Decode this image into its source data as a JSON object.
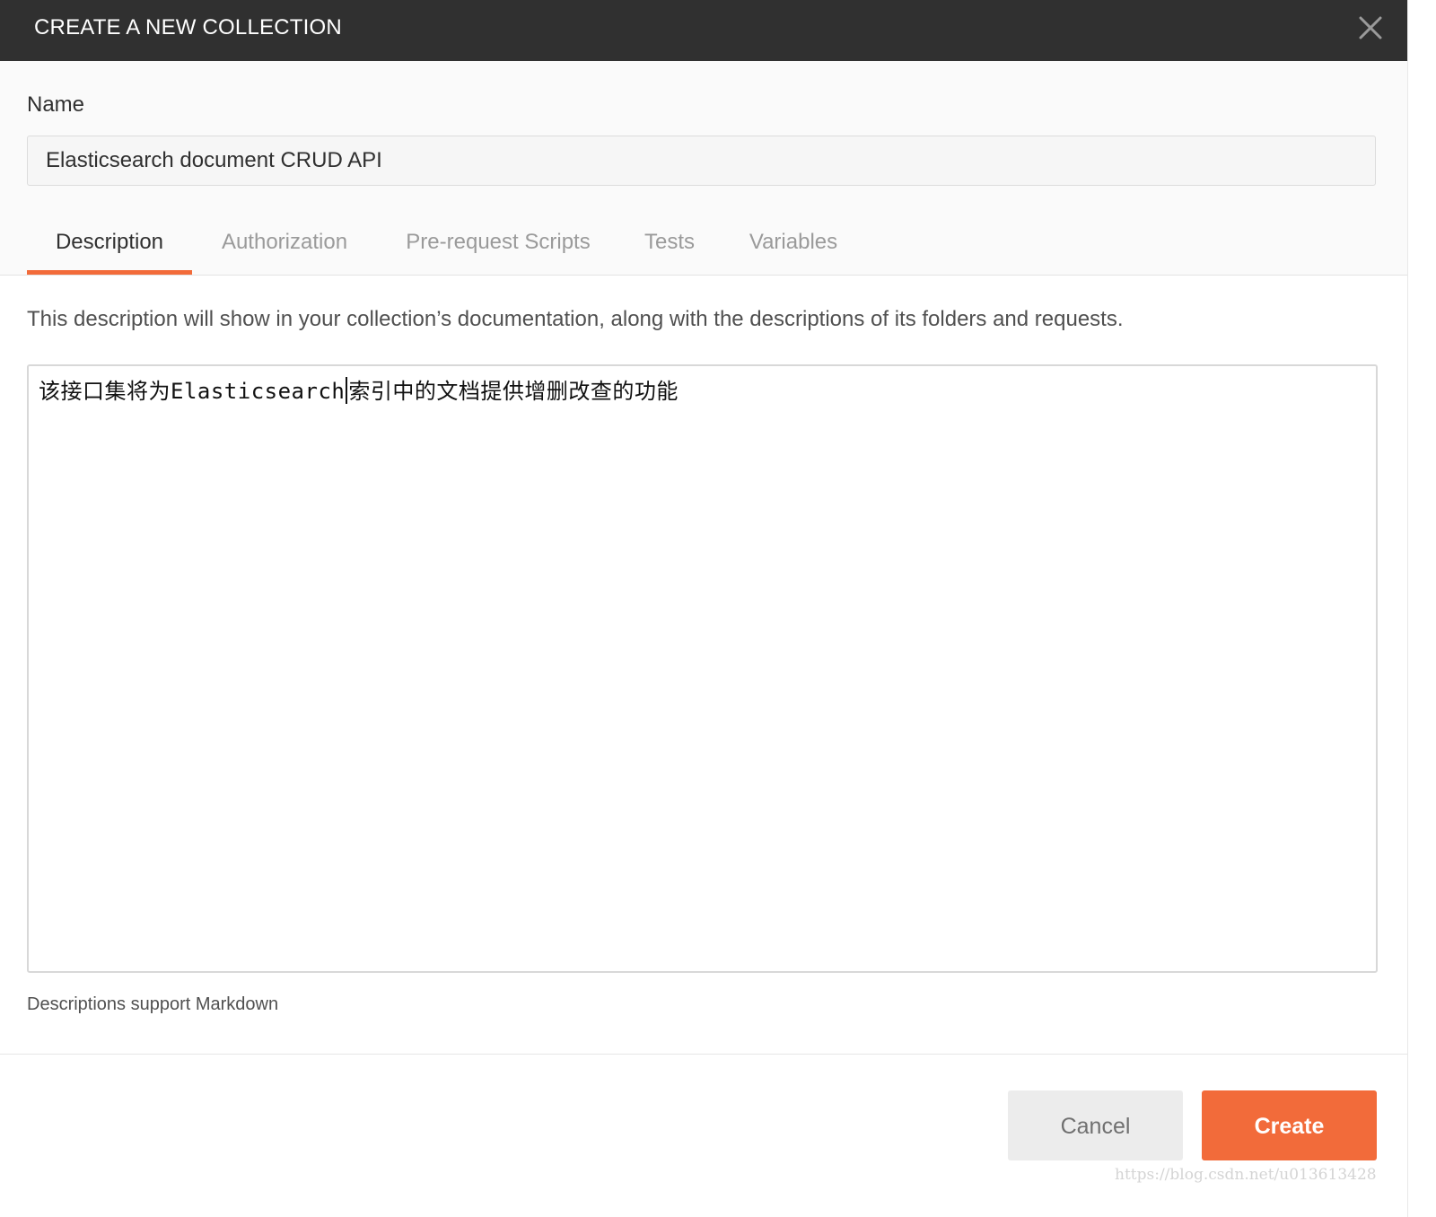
{
  "dialog": {
    "title": "CREATE A NEW COLLECTION",
    "close_icon": "close-icon"
  },
  "name_field": {
    "label": "Name",
    "value": "Elasticsearch document CRUD API"
  },
  "tabs": [
    {
      "label": "Description",
      "active": true
    },
    {
      "label": "Authorization",
      "active": false
    },
    {
      "label": "Pre-request Scripts",
      "active": false
    },
    {
      "label": "Tests",
      "active": false
    },
    {
      "label": "Variables",
      "active": false
    }
  ],
  "description": {
    "hint": "This description will show in your collection’s documentation, along with the descriptions of its folders and requests.",
    "text_before_caret": "该接口集将为Elasticsearch",
    "text_after_caret": "索引中的文档提供增删改查的功能",
    "markdown_note": "Descriptions support Markdown"
  },
  "footer": {
    "cancel_label": "Cancel",
    "create_label": "Create"
  },
  "watermark": "https://blog.csdn.net/u013613428",
  "colors": {
    "header_bg": "#303030",
    "accent": "#f26b3a",
    "cancel_bg": "#ececec"
  }
}
